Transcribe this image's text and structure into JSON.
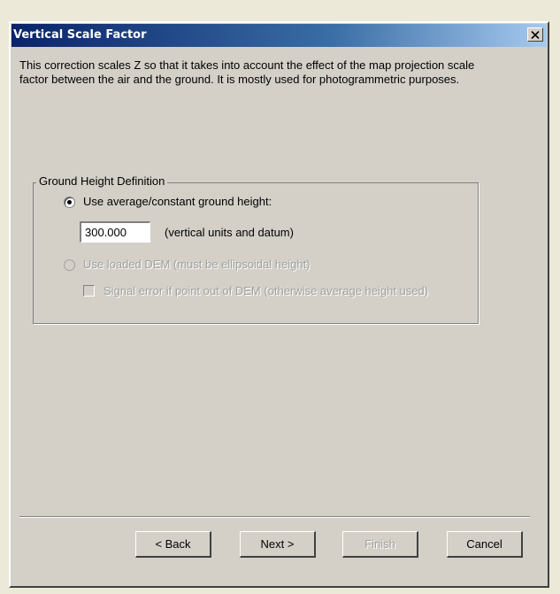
{
  "window": {
    "title": "Vertical Scale Factor",
    "close_glyph": "✕"
  },
  "description": "This correction scales Z so that it takes into account the effect of the map projection scale factor between the air and the ground.  It is mostly used for photogrammetric purposes.",
  "group": {
    "legend": "Ground Height Definition",
    "option_constant": {
      "label": "Use average/constant ground height:",
      "selected": true
    },
    "height_value": "300.000",
    "height_units_label": "(vertical units and datum)",
    "option_dem": {
      "label": "Use loaded DEM (must be ellipsoidal height)",
      "selected": false,
      "enabled": false
    },
    "signal_error": {
      "label": "Signal error if point out of DEM (otherwise average height used)",
      "checked": false,
      "enabled": false
    }
  },
  "buttons": {
    "back": "< Back",
    "next": "Next >",
    "finish": "Finish",
    "cancel": "Cancel"
  }
}
